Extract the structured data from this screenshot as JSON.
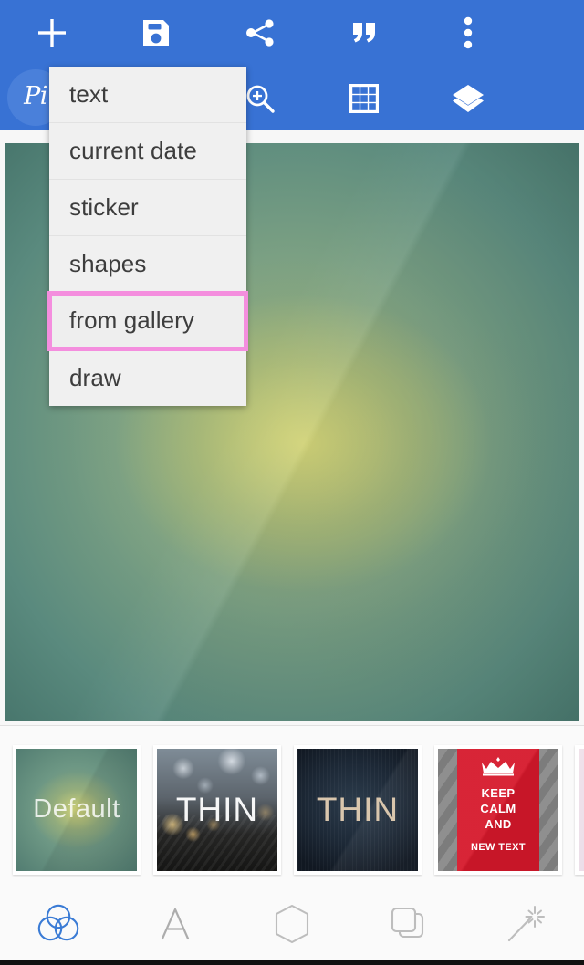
{
  "app": {
    "brand_label": "Pi",
    "toolbar_color": "#3872d4",
    "highlight_color": "#f48ede",
    "accent_color": "#3a7bd5"
  },
  "toolbar": {
    "row1": [
      {
        "name": "add-button",
        "icon": "plus-icon",
        "label": "add"
      },
      {
        "name": "save-button",
        "icon": "floppy-disk-icon",
        "label": "save"
      },
      {
        "name": "share-button",
        "icon": "share-icon",
        "label": "share"
      },
      {
        "name": "quote-button",
        "icon": "quote-icon",
        "label": "quote"
      },
      {
        "name": "overflow-menu-button",
        "icon": "three-dots-vertical-icon",
        "label": "more options"
      }
    ],
    "row2": [
      {
        "name": "brand-logo",
        "icon": "pixteller-logo-icon",
        "label": "Pi"
      },
      {
        "name": "spacer-slot",
        "icon": "none",
        "label": ""
      },
      {
        "name": "zoom-in-button",
        "icon": "magnifier-plus-icon",
        "label": "zoom in"
      },
      {
        "name": "grid-button",
        "icon": "grid-3x3-icon",
        "label": "grid"
      },
      {
        "name": "layers-button",
        "icon": "layers-icon",
        "label": "layers"
      }
    ]
  },
  "dropdown": {
    "open": true,
    "items": [
      {
        "label": "text",
        "highlighted": false
      },
      {
        "label": "current date",
        "highlighted": false
      },
      {
        "label": "sticker",
        "highlighted": false
      },
      {
        "label": "shapes",
        "highlighted": false
      },
      {
        "label": "from gallery",
        "highlighted": true
      },
      {
        "label": "draw",
        "highlighted": false
      }
    ]
  },
  "canvas": {
    "name": "design-canvas",
    "background_style": "teal-green radial gradient with yellow-green center glow"
  },
  "thumbnails": [
    {
      "label": "Default",
      "style": "default-teal",
      "selected": true
    },
    {
      "label": "THIN",
      "style": "bokeh",
      "selected": false
    },
    {
      "label": "THIN",
      "style": "navy",
      "selected": false
    },
    {
      "label": "",
      "style": "keep-calm",
      "selected": false,
      "keep_calm_lines": [
        "KEEP",
        "CALM",
        "AND"
      ],
      "keep_calm_footer": "NEW TEXT"
    },
    {
      "label": "",
      "style": "pale",
      "selected": false
    }
  ],
  "bottom_nav": [
    {
      "name": "tab-backgrounds",
      "icon": "venn-circles-icon",
      "label": "backgrounds",
      "active": true
    },
    {
      "name": "tab-text",
      "icon": "letter-a-icon",
      "label": "text",
      "active": false
    },
    {
      "name": "tab-shapes",
      "icon": "hexagon-icon",
      "label": "shapes",
      "active": false
    },
    {
      "name": "tab-layers",
      "icon": "copy-layers-icon",
      "label": "layers",
      "active": false
    },
    {
      "name": "tab-effects",
      "icon": "magic-wand-icon",
      "label": "effects",
      "active": false
    }
  ]
}
